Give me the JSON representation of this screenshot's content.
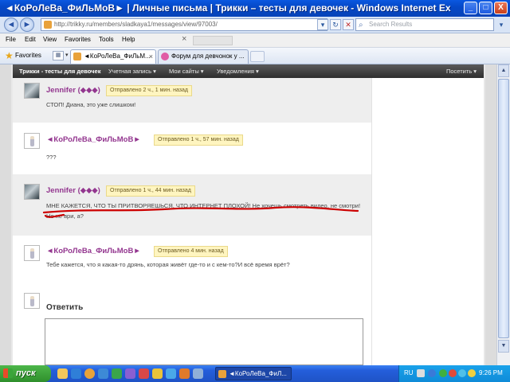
{
  "window": {
    "title": "◄КоРоЛеВа_ФиЛьМоВ► | Личные письма | Трикки – тесты для девочек - Windows Internet Expl...",
    "minimize": "_",
    "maximize": "□",
    "close": "X"
  },
  "address": {
    "back": "◄",
    "forward": "►",
    "url": "http://trikky.ru/members/sladkaya1/messages/view/97003/",
    "search_placeholder": "Search Results",
    "dropdown": "▾",
    "refresh": "↻",
    "stop": "✕",
    "search_go": "▾"
  },
  "menu": {
    "items": [
      "File",
      "Edit",
      "View",
      "Favorites",
      "Tools",
      "Help"
    ],
    "close": "×"
  },
  "favorites_bar": {
    "label": "Favorites",
    "tabs": [
      {
        "label": "◄КоРоЛеВа_ФиЛьМ...",
        "close": "×"
      },
      {
        "label": "Форум для девчонок у ..."
      }
    ]
  },
  "site_nav": {
    "brand": "Трикки - тесты для девочек",
    "account": "Учетная запись ▾",
    "my_sites": "Мои сайты ▾",
    "notifications": "Уведомления ▾",
    "visit": "Посетить ▾"
  },
  "messages": [
    {
      "author": "Jennifer (◆◆◆)",
      "time": "Отправлено 2 ч., 1 мин. назад",
      "lines": [
        "СТОП! Диана, это уже слишком!"
      ]
    },
    {
      "author": "◄КоРоЛеВа_ФиЛьМоВ►",
      "time": "Отправлено 1 ч., 57 мин. назад",
      "lines": [
        "???"
      ]
    },
    {
      "author": "Jennifer (◆◆◆)",
      "time": "Отправлено 1 ч., 44 мин. назад",
      "lines": [
        "МНЕ КАЖЕТСЯ, ЧТО ТЫ ПРИТВОРЯЕШЬСЯ, ЧТО ИНТЕРНЕТ ПЛОХОЙ! Не хочешь смотреть видео, не смотри!",
        "Но не ври, а?"
      ]
    },
    {
      "author": "◄КоРоЛеВа_ФиЛьМоВ►",
      "time": "Отправлено 4 мин. назад",
      "lines": [
        "Тебе кажется, что я какая-то дрянь, которая живёт где-то и с кем-то?И всё время врёт?"
      ]
    }
  ],
  "reply": {
    "title": "Ответить"
  },
  "annotation_color": "#cc0000",
  "taskbar": {
    "start": "пуск",
    "task": "◄КоРоЛеВа_ФиЛ...",
    "lang": "RU",
    "clock": "9:26 PM"
  }
}
